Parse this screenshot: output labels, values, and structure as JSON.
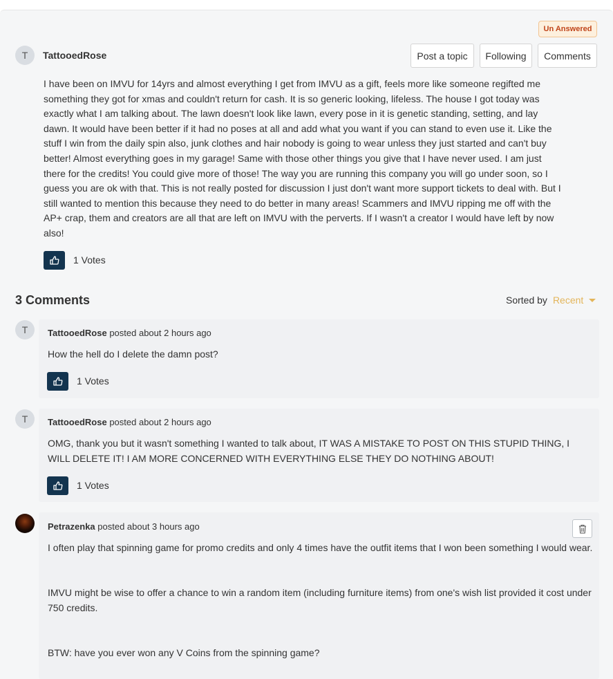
{
  "status_badge": "Un Answered",
  "post": {
    "author_initial": "T",
    "author": "TattooedRose",
    "actions": {
      "post_topic": "Post a topic",
      "following": "Following",
      "comments": "Comments"
    },
    "body": "I have been on IMVU for 14yrs and almost everything I get from IMVU as a gift, feels more like someone regifted me something they got for xmas and couldn't return for cash. It is so generic looking, lifeless. The house I got today was exactly what I am talking about. The lawn doesn't look like lawn, every pose in it is genetic standing, setting, and lay dawn. It would have been better if it had no poses at all and add what you want if you can stand to even use it. Like the stuff I win from the daily spin also, junk clothes and hair nobody is going to wear unless they just started and can't buy better! Almost everything goes in my garage! Same with those other things you give that I have never used. I am just there for the credits! You could give more of those! The way you are running this company you will go under soon, so I guess you are ok with that. This is not really posted for discussion I just don't want more support tickets to deal with. But I still wanted to mention this because they need to do better in many areas! Scammers and IMVU ripping me off with the AP+ crap, them and creators are all that are left on IMVU with the perverts. If I wasn't a creator I would have left by now also!",
    "votes": "1 Votes"
  },
  "comments_section": {
    "title": "3 Comments",
    "sorted_by_label": "Sorted by",
    "sorted_by_value": "Recent"
  },
  "comments": [
    {
      "initial": "T",
      "author": "TattooedRose",
      "meta": " posted about 2 hours ago",
      "text": "How the hell do I delete the damn post?",
      "votes": "1 Votes"
    },
    {
      "initial": "T",
      "author": "TattooedRose",
      "meta": " posted about 2 hours ago",
      "text": "OMG, thank you but it wasn't something I wanted to talk about, IT WAS A MISTAKE TO POST ON THIS STUPID THING, I WILL DELETE IT! I AM MORE CONCERNED WITH EVERYTHING ELSE THEY DO NOTHING ABOUT!",
      "votes": "1 Votes"
    },
    {
      "author": "Petrazenka",
      "meta": " posted about 3 hours ago",
      "p1": "I often play that spinning game for promo credits and only 4 times have the outfit items that I won been something I would wear.",
      "p2": "IMVU might be wise to offer a chance to win a random item (including furniture items) from one's wish list provided it cost under 750 credits.",
      "p3": "BTW: have you ever won any V Coins from the spinning game?"
    }
  ],
  "icons": {
    "vote": "thumbs-up-icon",
    "delete": "trash-icon"
  },
  "colors": {
    "vote_button": "#13344f",
    "badge_text": "#c0441a",
    "sort_accent": "#e3b55a"
  }
}
